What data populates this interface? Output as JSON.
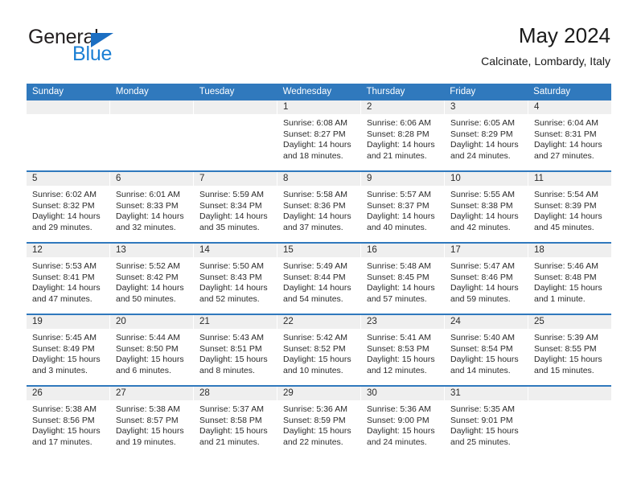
{
  "brand": {
    "line1": "General",
    "line2": "Blue",
    "accent_color": "#1b7fd4",
    "triangle_color": "#1b6ec2"
  },
  "header": {
    "title": "May 2024",
    "subtitle": "Calcinate, Lombardy, Italy"
  },
  "calendar": {
    "header_color": "#3079bd",
    "weekdays": [
      "Sunday",
      "Monday",
      "Tuesday",
      "Wednesday",
      "Thursday",
      "Friday",
      "Saturday"
    ],
    "weeks": [
      [
        {
          "day": "",
          "empty": true
        },
        {
          "day": "",
          "empty": true
        },
        {
          "day": "",
          "empty": true
        },
        {
          "day": "1",
          "sunrise": "Sunrise: 6:08 AM",
          "sunset": "Sunset: 8:27 PM",
          "daylight": "Daylight: 14 hours and 18 minutes."
        },
        {
          "day": "2",
          "sunrise": "Sunrise: 6:06 AM",
          "sunset": "Sunset: 8:28 PM",
          "daylight": "Daylight: 14 hours and 21 minutes."
        },
        {
          "day": "3",
          "sunrise": "Sunrise: 6:05 AM",
          "sunset": "Sunset: 8:29 PM",
          "daylight": "Daylight: 14 hours and 24 minutes."
        },
        {
          "day": "4",
          "sunrise": "Sunrise: 6:04 AM",
          "sunset": "Sunset: 8:31 PM",
          "daylight": "Daylight: 14 hours and 27 minutes."
        }
      ],
      [
        {
          "day": "5",
          "sunrise": "Sunrise: 6:02 AM",
          "sunset": "Sunset: 8:32 PM",
          "daylight": "Daylight: 14 hours and 29 minutes."
        },
        {
          "day": "6",
          "sunrise": "Sunrise: 6:01 AM",
          "sunset": "Sunset: 8:33 PM",
          "daylight": "Daylight: 14 hours and 32 minutes."
        },
        {
          "day": "7",
          "sunrise": "Sunrise: 5:59 AM",
          "sunset": "Sunset: 8:34 PM",
          "daylight": "Daylight: 14 hours and 35 minutes."
        },
        {
          "day": "8",
          "sunrise": "Sunrise: 5:58 AM",
          "sunset": "Sunset: 8:36 PM",
          "daylight": "Daylight: 14 hours and 37 minutes."
        },
        {
          "day": "9",
          "sunrise": "Sunrise: 5:57 AM",
          "sunset": "Sunset: 8:37 PM",
          "daylight": "Daylight: 14 hours and 40 minutes."
        },
        {
          "day": "10",
          "sunrise": "Sunrise: 5:55 AM",
          "sunset": "Sunset: 8:38 PM",
          "daylight": "Daylight: 14 hours and 42 minutes."
        },
        {
          "day": "11",
          "sunrise": "Sunrise: 5:54 AM",
          "sunset": "Sunset: 8:39 PM",
          "daylight": "Daylight: 14 hours and 45 minutes."
        }
      ],
      [
        {
          "day": "12",
          "sunrise": "Sunrise: 5:53 AM",
          "sunset": "Sunset: 8:41 PM",
          "daylight": "Daylight: 14 hours and 47 minutes."
        },
        {
          "day": "13",
          "sunrise": "Sunrise: 5:52 AM",
          "sunset": "Sunset: 8:42 PM",
          "daylight": "Daylight: 14 hours and 50 minutes."
        },
        {
          "day": "14",
          "sunrise": "Sunrise: 5:50 AM",
          "sunset": "Sunset: 8:43 PM",
          "daylight": "Daylight: 14 hours and 52 minutes."
        },
        {
          "day": "15",
          "sunrise": "Sunrise: 5:49 AM",
          "sunset": "Sunset: 8:44 PM",
          "daylight": "Daylight: 14 hours and 54 minutes."
        },
        {
          "day": "16",
          "sunrise": "Sunrise: 5:48 AM",
          "sunset": "Sunset: 8:45 PM",
          "daylight": "Daylight: 14 hours and 57 minutes."
        },
        {
          "day": "17",
          "sunrise": "Sunrise: 5:47 AM",
          "sunset": "Sunset: 8:46 PM",
          "daylight": "Daylight: 14 hours and 59 minutes."
        },
        {
          "day": "18",
          "sunrise": "Sunrise: 5:46 AM",
          "sunset": "Sunset: 8:48 PM",
          "daylight": "Daylight: 15 hours and 1 minute."
        }
      ],
      [
        {
          "day": "19",
          "sunrise": "Sunrise: 5:45 AM",
          "sunset": "Sunset: 8:49 PM",
          "daylight": "Daylight: 15 hours and 3 minutes."
        },
        {
          "day": "20",
          "sunrise": "Sunrise: 5:44 AM",
          "sunset": "Sunset: 8:50 PM",
          "daylight": "Daylight: 15 hours and 6 minutes."
        },
        {
          "day": "21",
          "sunrise": "Sunrise: 5:43 AM",
          "sunset": "Sunset: 8:51 PM",
          "daylight": "Daylight: 15 hours and 8 minutes."
        },
        {
          "day": "22",
          "sunrise": "Sunrise: 5:42 AM",
          "sunset": "Sunset: 8:52 PM",
          "daylight": "Daylight: 15 hours and 10 minutes."
        },
        {
          "day": "23",
          "sunrise": "Sunrise: 5:41 AM",
          "sunset": "Sunset: 8:53 PM",
          "daylight": "Daylight: 15 hours and 12 minutes."
        },
        {
          "day": "24",
          "sunrise": "Sunrise: 5:40 AM",
          "sunset": "Sunset: 8:54 PM",
          "daylight": "Daylight: 15 hours and 14 minutes."
        },
        {
          "day": "25",
          "sunrise": "Sunrise: 5:39 AM",
          "sunset": "Sunset: 8:55 PM",
          "daylight": "Daylight: 15 hours and 15 minutes."
        }
      ],
      [
        {
          "day": "26",
          "sunrise": "Sunrise: 5:38 AM",
          "sunset": "Sunset: 8:56 PM",
          "daylight": "Daylight: 15 hours and 17 minutes."
        },
        {
          "day": "27",
          "sunrise": "Sunrise: 5:38 AM",
          "sunset": "Sunset: 8:57 PM",
          "daylight": "Daylight: 15 hours and 19 minutes."
        },
        {
          "day": "28",
          "sunrise": "Sunrise: 5:37 AM",
          "sunset": "Sunset: 8:58 PM",
          "daylight": "Daylight: 15 hours and 21 minutes."
        },
        {
          "day": "29",
          "sunrise": "Sunrise: 5:36 AM",
          "sunset": "Sunset: 8:59 PM",
          "daylight": "Daylight: 15 hours and 22 minutes."
        },
        {
          "day": "30",
          "sunrise": "Sunrise: 5:36 AM",
          "sunset": "Sunset: 9:00 PM",
          "daylight": "Daylight: 15 hours and 24 minutes."
        },
        {
          "day": "31",
          "sunrise": "Sunrise: 5:35 AM",
          "sunset": "Sunset: 9:01 PM",
          "daylight": "Daylight: 15 hours and 25 minutes."
        },
        {
          "day": "",
          "empty": true
        }
      ]
    ]
  }
}
